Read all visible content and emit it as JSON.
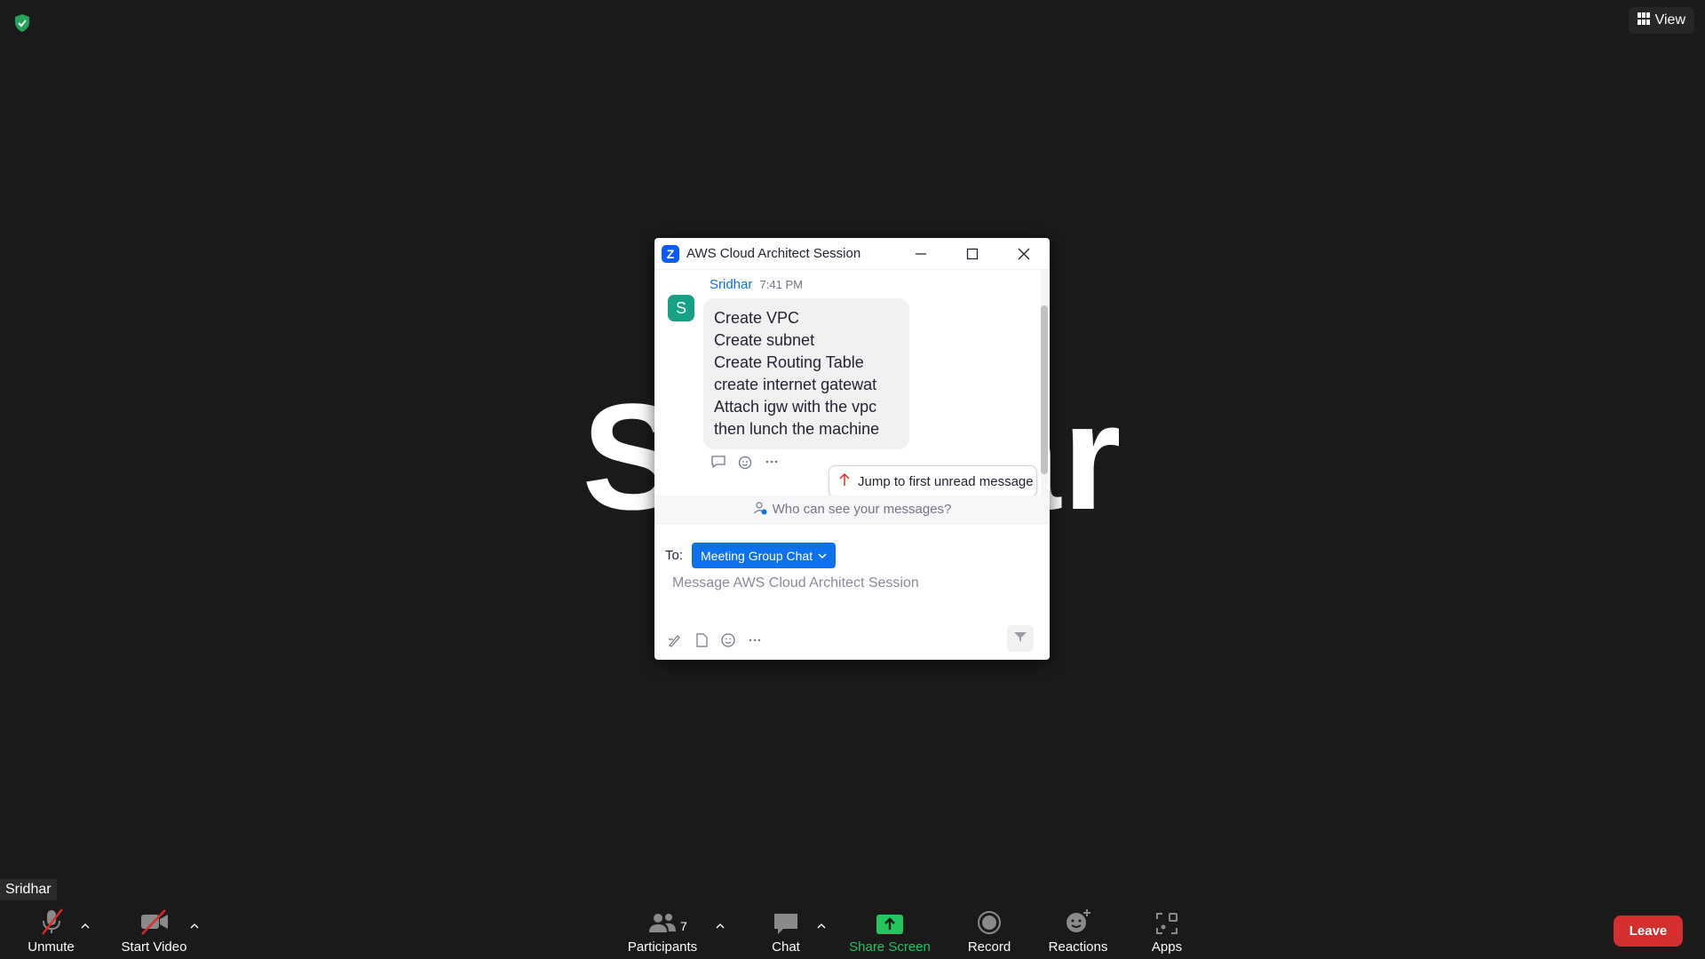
{
  "top": {
    "view_label": "View"
  },
  "stage": {
    "participant_name_display": "Sridhar"
  },
  "chat": {
    "window_title": "AWS Cloud Architect Session",
    "message": {
      "sender": "Sridhar",
      "time": "7:41 PM",
      "avatar_letter": "S",
      "lines": [
        "Create VPC",
        "Create subnet",
        "Create Routing Table",
        "create internet gatewat",
        "Attach igw with the vpc",
        "then lunch the machine"
      ]
    },
    "jump_label": "Jump to first unread message",
    "who_can_see": "Who can see your messages?",
    "to_label": "To:",
    "recipient": "Meeting Group Chat",
    "input_placeholder": "Message AWS Cloud Architect Session"
  },
  "name_tag": "Sridhar",
  "toolbar": {
    "unmute": "Unmute",
    "start_video": "Start Video",
    "participants": "Participants",
    "participant_count": "7",
    "chat": "Chat",
    "share_screen": "Share Screen",
    "record": "Record",
    "reactions": "Reactions",
    "apps": "Apps",
    "leave": "Leave"
  },
  "colors": {
    "accent": "#0e72ed",
    "share": "#22c55e",
    "leave": "#d32f2f",
    "avatar": "#16a085"
  }
}
